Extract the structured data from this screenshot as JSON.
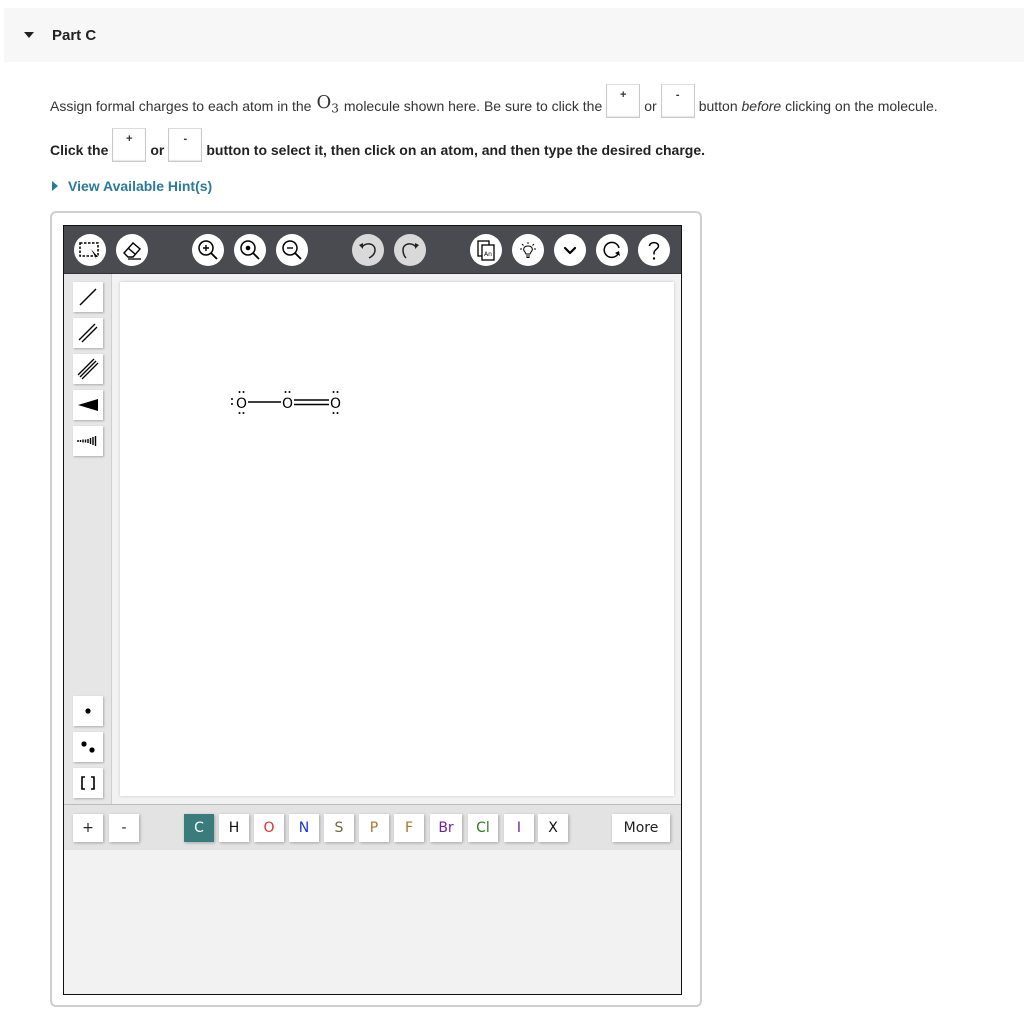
{
  "part": {
    "title": "Part C",
    "expanded": true
  },
  "instructions": {
    "line1_a": "Assign formal charges to each atom in the",
    "formula_base": "O",
    "formula_sub": "3",
    "line1_b": "molecule shown here. Be sure to click the",
    "plus_label": "+",
    "or_1": "or",
    "minus_label": "-",
    "line1_c": "button",
    "line1_em": "before",
    "line1_d": "clicking on the molecule.",
    "line2_a": "Click the",
    "or_2": "or",
    "line2_b": "button to select it, then click on an atom, and then type the desired charge."
  },
  "hint": {
    "label": "View Available Hint(s)"
  },
  "toolbar": {
    "items": [
      {
        "name": "marquee-select",
        "label": "Select",
        "enabled": true
      },
      {
        "name": "eraser",
        "label": "Erase",
        "enabled": true
      },
      {
        "name": "zoom-in",
        "label": "Zoom in",
        "enabled": true
      },
      {
        "name": "zoom-reset",
        "label": "Reset zoom",
        "enabled": true
      },
      {
        "name": "zoom-out",
        "label": "Zoom out",
        "enabled": true
      },
      {
        "name": "undo",
        "label": "Undo",
        "enabled": false
      },
      {
        "name": "redo",
        "label": "Redo",
        "enabled": false
      },
      {
        "name": "templates",
        "label": "An",
        "enabled": true
      },
      {
        "name": "hint-bulb",
        "label": "Hint",
        "enabled": true
      },
      {
        "name": "more-tools",
        "label": "More",
        "enabled": true
      },
      {
        "name": "reset",
        "label": "Reset",
        "enabled": true
      },
      {
        "name": "help",
        "label": "?",
        "enabled": true
      }
    ]
  },
  "left_tools": {
    "bonds": [
      "single-bond",
      "double-bond",
      "triple-bond",
      "wedge-bond",
      "hash-bond"
    ],
    "electrons": [
      "radical",
      "lone-pair",
      "brackets"
    ],
    "brackets_label": "[ ]"
  },
  "molecule": {
    "name": "O3",
    "atoms": [
      {
        "symbol": "O",
        "lone_pairs": 3
      },
      {
        "symbol": "O",
        "lone_pairs": 1
      },
      {
        "symbol": "O",
        "lone_pairs": 2
      }
    ],
    "bonds": [
      {
        "from": 0,
        "to": 1,
        "order": 1
      },
      {
        "from": 1,
        "to": 2,
        "order": 2
      }
    ]
  },
  "bottom_bar": {
    "charges": [
      {
        "label": "+",
        "name": "plus-charge"
      },
      {
        "label": "-",
        "name": "minus-charge"
      }
    ],
    "elements": [
      {
        "label": "C",
        "color": "#3a7b7b",
        "selected": true
      },
      {
        "label": "H",
        "color": "#111111",
        "selected": false
      },
      {
        "label": "O",
        "color": "#e0302a",
        "selected": false
      },
      {
        "label": "N",
        "color": "#1a33d6",
        "selected": false
      },
      {
        "label": "S",
        "color": "#6e6a3e",
        "selected": false
      },
      {
        "label": "P",
        "color": "#a9742a",
        "selected": false
      },
      {
        "label": "F",
        "color": "#a9742a",
        "selected": false
      },
      {
        "label": "Br",
        "color": "#6a23a8",
        "selected": false
      },
      {
        "label": "Cl",
        "color": "#2f7a1f",
        "selected": false
      },
      {
        "label": "I",
        "color": "#6a23a8",
        "selected": false
      },
      {
        "label": "X",
        "color": "#111111",
        "selected": false
      }
    ],
    "more_label": "More"
  },
  "colors": {
    "toolbar_bg": "#4a4a51",
    "hint_link": "#2a7a9a",
    "selected_element_bg": "#3a7b7b"
  }
}
